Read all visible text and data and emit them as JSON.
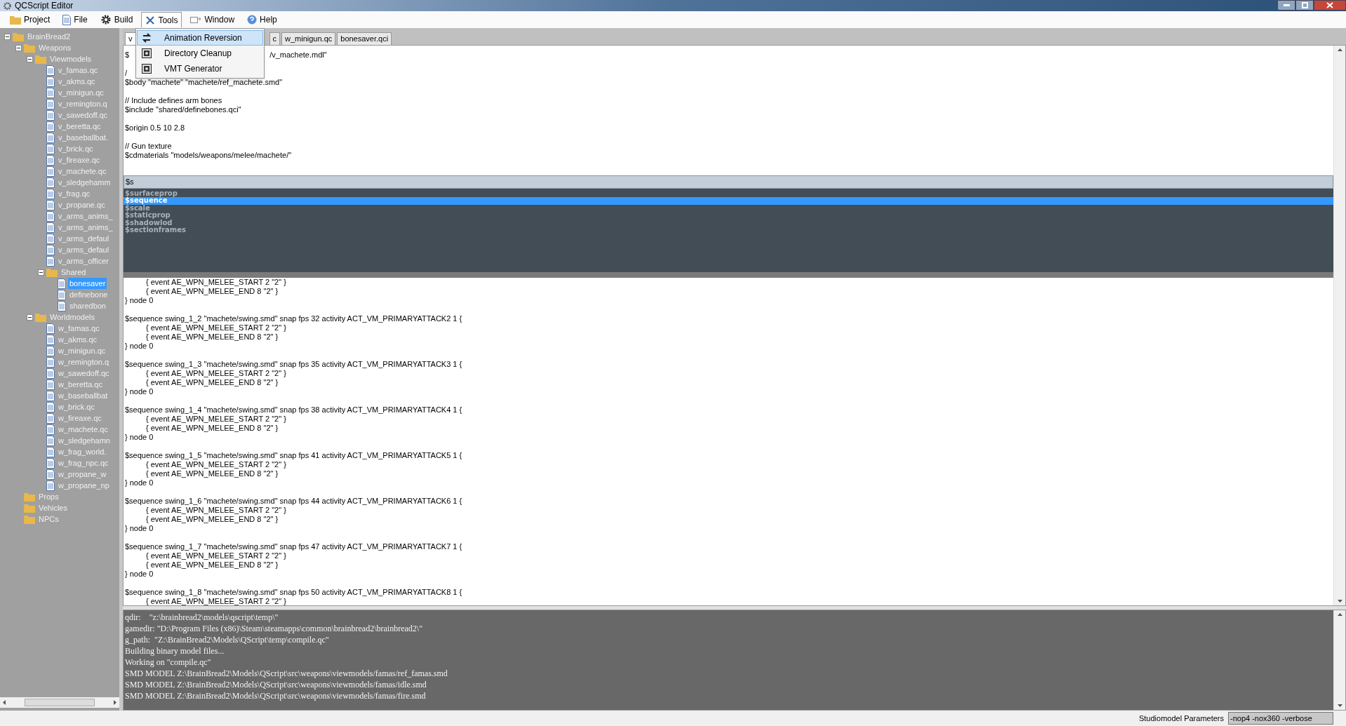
{
  "window": {
    "title": "QCScript Editor"
  },
  "menu_bar": [
    {
      "label": "Project",
      "selected": false
    },
    {
      "label": "File",
      "selected": false
    },
    {
      "label": "Build",
      "selected": false
    },
    {
      "label": "Tools",
      "selected": true
    },
    {
      "label": "Window",
      "selected": false
    },
    {
      "label": "Help",
      "selected": false
    }
  ],
  "tools_menu": [
    {
      "label": "Animation Reversion",
      "selected": true
    },
    {
      "label": "Directory Cleanup",
      "selected": false
    },
    {
      "label": "VMT Generator",
      "selected": false
    }
  ],
  "tree": [
    {
      "label": "BrainBread2",
      "kind": "folder",
      "expanded": true,
      "selected": false,
      "children": [
        {
          "label": "Weapons",
          "kind": "folder",
          "expanded": true,
          "selected": false,
          "children": [
            {
              "label": "Viewmodels",
              "kind": "folder",
              "expanded": true,
              "selected": false,
              "children": [
                {
                  "label": "v_famas.qc",
                  "kind": "file",
                  "selected": false
                },
                {
                  "label": "v_akms.qc",
                  "kind": "file",
                  "selected": false
                },
                {
                  "label": "v_minigun.qc",
                  "kind": "file",
                  "selected": false
                },
                {
                  "label": "v_remington.q",
                  "kind": "file",
                  "selected": false
                },
                {
                  "label": "v_sawedoff.qc",
                  "kind": "file",
                  "selected": false
                },
                {
                  "label": "v_beretta.qc",
                  "kind": "file",
                  "selected": false
                },
                {
                  "label": "v_baseballbat.",
                  "kind": "file",
                  "selected": false
                },
                {
                  "label": "v_brick.qc",
                  "kind": "file",
                  "selected": false
                },
                {
                  "label": "v_fireaxe.qc",
                  "kind": "file",
                  "selected": false
                },
                {
                  "label": "v_machete.qc",
                  "kind": "file",
                  "selected": false
                },
                {
                  "label": "v_sledgehamm",
                  "kind": "file",
                  "selected": false
                },
                {
                  "label": "v_frag.qc",
                  "kind": "file",
                  "selected": false
                },
                {
                  "label": "v_propane.qc",
                  "kind": "file",
                  "selected": false
                },
                {
                  "label": "v_arms_anims_",
                  "kind": "file",
                  "selected": false
                },
                {
                  "label": "v_arms_anims_",
                  "kind": "file",
                  "selected": false
                },
                {
                  "label": "v_arms_defaul",
                  "kind": "file",
                  "selected": false
                },
                {
                  "label": "v_arms_defaul",
                  "kind": "file",
                  "selected": false
                },
                {
                  "label": "v_arms_officer",
                  "kind": "file",
                  "selected": false
                },
                {
                  "label": "Shared",
                  "kind": "folder",
                  "expanded": true,
                  "selected": false,
                  "children": [
                    {
                      "label": "bonesaver",
                      "kind": "file",
                      "selected": true
                    },
                    {
                      "label": "definebone",
                      "kind": "file",
                      "selected": false
                    },
                    {
                      "label": "sharedbon",
                      "kind": "file",
                      "selected": false
                    }
                  ]
                }
              ]
            },
            {
              "label": "Worldmodels",
              "kind": "folder",
              "expanded": true,
              "selected": false,
              "children": [
                {
                  "label": "w_famas.qc",
                  "kind": "file",
                  "selected": false
                },
                {
                  "label": "w_akms.qc",
                  "kind": "file",
                  "selected": false
                },
                {
                  "label": "w_minigun.qc",
                  "kind": "file",
                  "selected": false
                },
                {
                  "label": "w_remington.q",
                  "kind": "file",
                  "selected": false
                },
                {
                  "label": "w_sawedoff.qc",
                  "kind": "file",
                  "selected": false
                },
                {
                  "label": "w_beretta.qc",
                  "kind": "file",
                  "selected": false
                },
                {
                  "label": "w_baseballbat",
                  "kind": "file",
                  "selected": false
                },
                {
                  "label": "w_brick.qc",
                  "kind": "file",
                  "selected": false
                },
                {
                  "label": "w_fireaxe.qc",
                  "kind": "file",
                  "selected": false
                },
                {
                  "label": "w_machete.qc",
                  "kind": "file",
                  "selected": false
                },
                {
                  "label": "w_sledgehamn",
                  "kind": "file",
                  "selected": false
                },
                {
                  "label": "w_frag_world.",
                  "kind": "file",
                  "selected": false
                },
                {
                  "label": "w_frag_npc.qc",
                  "kind": "file",
                  "selected": false
                },
                {
                  "label": "w_propane_w",
                  "kind": "file",
                  "selected": false
                },
                {
                  "label": "w_propane_np",
                  "kind": "file",
                  "selected": false
                }
              ]
            }
          ]
        },
        {
          "label": "Props",
          "kind": "folder",
          "selected": false
        },
        {
          "label": "Vehicles",
          "kind": "folder",
          "selected": false
        },
        {
          "label": "NPCs",
          "kind": "folder",
          "selected": false
        }
      ]
    }
  ],
  "tabs": [
    {
      "label": "v",
      "selected": true
    },
    {
      "label": "c",
      "selected": false
    },
    {
      "label": "w_minigun.qc",
      "selected": false
    },
    {
      "label": "bonesaver.qci",
      "selected": false
    }
  ],
  "code_top": [
    {
      "kind": "split",
      "text": "$",
      "tail": "/v_machete.mdl\""
    },
    {
      "kind": "blank"
    },
    {
      "kind": "line",
      "text": "/"
    },
    {
      "kind": "line",
      "text": "$body \"machete\" \"machete/ref_machete.smd\""
    },
    {
      "kind": "blank"
    },
    {
      "kind": "line",
      "text": "// Include defines arm bones"
    },
    {
      "kind": "line",
      "text": "$include \"shared/definebones.qci\""
    },
    {
      "kind": "blank"
    },
    {
      "kind": "line",
      "text": "$origin 0.5 10 2.8"
    },
    {
      "kind": "blank"
    },
    {
      "kind": "line",
      "text": "// Gun texture"
    },
    {
      "kind": "line",
      "text": "$cdmaterials \"models/weapons/melee/machete/\""
    }
  ],
  "autocomplete": {
    "value": "$s",
    "items": [
      {
        "label": "$surfaceprop",
        "selected": false
      },
      {
        "label": "$sequence",
        "selected": true
      },
      {
        "label": "$scale",
        "selected": false
      },
      {
        "label": "$staticprop",
        "selected": false
      },
      {
        "label": "$shadowlod",
        "selected": false
      },
      {
        "label": "$sectionframes",
        "selected": false
      }
    ]
  },
  "code_bottom": [
    {
      "kind": "event",
      "text": "{ event AE_WPN_MELEE_START 2 \"2\" }"
    },
    {
      "kind": "event",
      "text": "{ event AE_WPN_MELEE_END 8 \"2\" }"
    },
    {
      "kind": "line",
      "text": "} node 0"
    },
    {
      "kind": "blank"
    },
    {
      "kind": "line",
      "text": "$sequence swing_1_2 \"machete/swing.smd\" snap fps 32 activity ACT_VM_PRIMARYATTACK2 1 {"
    },
    {
      "kind": "event",
      "text": "{ event AE_WPN_MELEE_START 2 \"2\" }"
    },
    {
      "kind": "event",
      "text": "{ event AE_WPN_MELEE_END 8 \"2\" }"
    },
    {
      "kind": "line",
      "text": "} node 0"
    },
    {
      "kind": "blank"
    },
    {
      "kind": "line",
      "text": "$sequence swing_1_3 \"machete/swing.smd\" snap fps 35 activity ACT_VM_PRIMARYATTACK3 1 {"
    },
    {
      "kind": "event",
      "text": "{ event AE_WPN_MELEE_START 2 \"2\" }"
    },
    {
      "kind": "event",
      "text": "{ event AE_WPN_MELEE_END 8 \"2\" }"
    },
    {
      "kind": "line",
      "text": "} node 0"
    },
    {
      "kind": "blank"
    },
    {
      "kind": "line",
      "text": "$sequence swing_1_4 \"machete/swing.smd\" snap fps 38 activity ACT_VM_PRIMARYATTACK4 1 {"
    },
    {
      "kind": "event",
      "text": "{ event AE_WPN_MELEE_START 2 \"2\" }"
    },
    {
      "kind": "event",
      "text": "{ event AE_WPN_MELEE_END 8 \"2\" }"
    },
    {
      "kind": "line",
      "text": "} node 0"
    },
    {
      "kind": "blank"
    },
    {
      "kind": "line",
      "text": "$sequence swing_1_5 \"machete/swing.smd\" snap fps 41 activity ACT_VM_PRIMARYATTACK5 1 {"
    },
    {
      "kind": "event",
      "text": "{ event AE_WPN_MELEE_START 2 \"2\" }"
    },
    {
      "kind": "event",
      "text": "{ event AE_WPN_MELEE_END 8 \"2\" }"
    },
    {
      "kind": "line",
      "text": "} node 0"
    },
    {
      "kind": "blank"
    },
    {
      "kind": "line",
      "text": "$sequence swing_1_6 \"machete/swing.smd\" snap fps 44 activity ACT_VM_PRIMARYATTACK6 1 {"
    },
    {
      "kind": "event",
      "text": "{ event AE_WPN_MELEE_START 2 \"2\" }"
    },
    {
      "kind": "event",
      "text": "{ event AE_WPN_MELEE_END 8 \"2\" }"
    },
    {
      "kind": "line",
      "text": "} node 0"
    },
    {
      "kind": "blank"
    },
    {
      "kind": "line",
      "text": "$sequence swing_1_7 \"machete/swing.smd\" snap fps 47 activity ACT_VM_PRIMARYATTACK7 1 {"
    },
    {
      "kind": "event",
      "text": "{ event AE_WPN_MELEE_START 2 \"2\" }"
    },
    {
      "kind": "event",
      "text": "{ event AE_WPN_MELEE_END 8 \"2\" }"
    },
    {
      "kind": "line",
      "text": "} node 0"
    },
    {
      "kind": "blank"
    },
    {
      "kind": "line",
      "text": "$sequence swing_1_8 \"machete/swing.smd\" snap fps 50 activity ACT_VM_PRIMARYATTACK8 1 {"
    },
    {
      "kind": "event",
      "text": "{ event AE_WPN_MELEE_START 2 \"2\" }"
    }
  ],
  "output": [
    "qdir:    \"z:\\brainbread2\\models\\qscript\\temp\\\"",
    "gamedir: \"D:\\Program Files (x86)\\Steam\\steamapps\\common\\brainbread2\\brainbread2\\\"",
    "g_path:  \"Z:\\BrainBread2\\Models\\QScript\\temp\\compile.qc\"",
    "Building binary model files...",
    "Working on \"compile.qc\"",
    "SMD MODEL Z:\\BrainBread2\\Models\\QScript\\src\\weapons\\viewmodels/famas/ref_famas.smd",
    "SMD MODEL Z:\\BrainBread2\\Models\\QScript\\src\\weapons\\viewmodels/famas/idle.smd",
    "SMD MODEL Z:\\BrainBread2\\Models\\QScript\\src\\weapons\\viewmodels/famas/fire.smd"
  ],
  "status_bar": {
    "label": "Studiomodel Parameters",
    "value": "-nop4 -nox360 -verbose"
  }
}
